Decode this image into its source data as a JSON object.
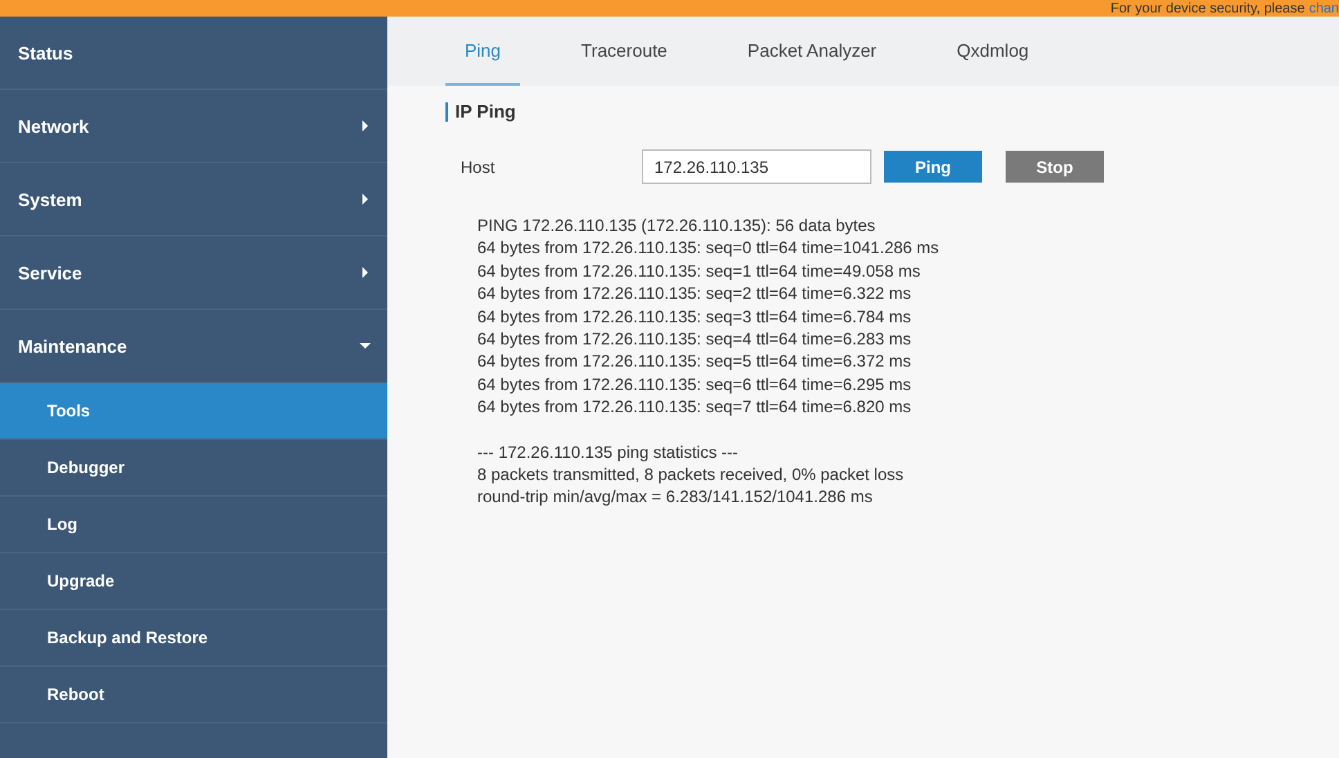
{
  "banner": {
    "text": "For your device security, please",
    "link": "chan"
  },
  "sidebar": {
    "items": [
      {
        "label": "Status",
        "kind": "page"
      },
      {
        "label": "Network",
        "kind": "group",
        "expanded": false
      },
      {
        "label": "System",
        "kind": "group",
        "expanded": false
      },
      {
        "label": "Service",
        "kind": "group",
        "expanded": false
      },
      {
        "label": "Maintenance",
        "kind": "group",
        "expanded": true,
        "children": [
          {
            "label": "Tools",
            "selected": true
          },
          {
            "label": "Debugger",
            "selected": false
          },
          {
            "label": "Log",
            "selected": false
          },
          {
            "label": "Upgrade",
            "selected": false
          },
          {
            "label": "Backup and Restore",
            "selected": false
          },
          {
            "label": "Reboot",
            "selected": false
          }
        ]
      }
    ]
  },
  "tabs": [
    {
      "label": "Ping",
      "selected": true
    },
    {
      "label": "Traceroute",
      "selected": false
    },
    {
      "label": "Packet Analyzer",
      "selected": false
    },
    {
      "label": "Qxdmlog",
      "selected": false
    }
  ],
  "section_title": "IP Ping",
  "host": {
    "label": "Host",
    "value": "172.26.110.135"
  },
  "buttons": [
    {
      "label": "Ping",
      "kind": "primary"
    },
    {
      "label": "Stop",
      "kind": "secondary"
    }
  ],
  "output": {
    "lines": [
      "PING 172.26.110.135 (172.26.110.135): 56 data bytes",
      "64 bytes from 172.26.110.135: seq=0 ttl=64 time=1041.286 ms",
      "64 bytes from 172.26.110.135: seq=1 ttl=64 time=49.058 ms",
      "64 bytes from 172.26.110.135: seq=2 ttl=64 time=6.322 ms",
      "64 bytes from 172.26.110.135: seq=3 ttl=64 time=6.784 ms",
      "64 bytes from 172.26.110.135: seq=4 ttl=64 time=6.283 ms",
      "64 bytes from 172.26.110.135: seq=5 ttl=64 time=6.372 ms",
      "64 bytes from 172.26.110.135: seq=6 ttl=64 time=6.295 ms",
      "64 bytes from 172.26.110.135: seq=7 ttl=64 time=6.820 ms"
    ],
    "stats": [
      "--- 172.26.110.135 ping statistics ---",
      "8 packets transmitted, 8 packets received, 0% packet loss",
      "round-trip min/avg/max = 6.283/141.152/1041.286 ms"
    ]
  }
}
